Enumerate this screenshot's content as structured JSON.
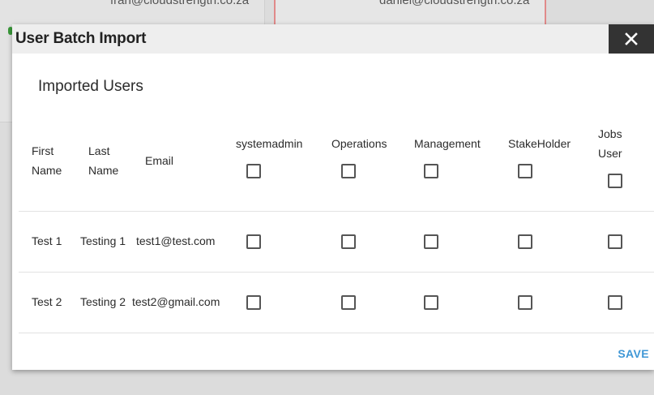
{
  "background": {
    "left_card_text": "fran@cloudstrength.co.za",
    "right_card_text": "daniel@cloudstrength.co.za"
  },
  "modal": {
    "title": "User Batch Import",
    "close_icon": "close-icon",
    "section_title": "Imported Users",
    "columns": {
      "first_name": "First Name",
      "last_name": "Last Name",
      "email": "Email",
      "role1": "systemadmin",
      "role2": "Operations",
      "role3": "Management",
      "role4": "StakeHolder",
      "role5": "Jobs User"
    },
    "rows": [
      {
        "first": "Test 1",
        "last": "Testing 1",
        "email": "test1@test.com"
      },
      {
        "first": "Test 2",
        "last": "Testing 2",
        "email": "test2@gmail.com"
      }
    ],
    "save_label": "SAVE"
  },
  "colors": {
    "save_accent": "#3f97d6",
    "close_bg": "#333333"
  }
}
